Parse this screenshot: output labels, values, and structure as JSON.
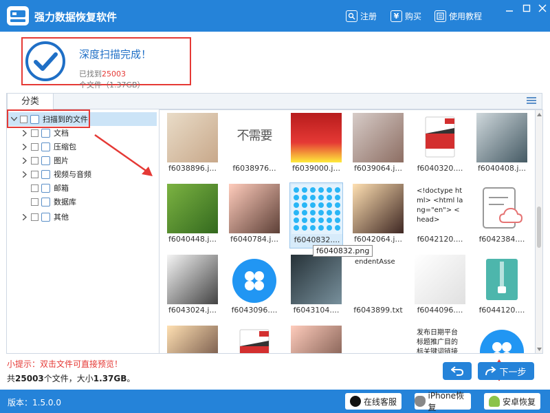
{
  "window": {
    "title": "强力数据恢复软件",
    "links": [
      {
        "label": "注册",
        "icon": "register-icon"
      },
      {
        "label": "购买",
        "icon": "yen-icon"
      },
      {
        "label": "使用教程",
        "icon": "tutorial-icon"
      }
    ]
  },
  "scan": {
    "title": "深度扫描完成！",
    "found_prefix": "已找到",
    "found_count": "25003",
    "found_suffix": "个文件（1.37GB）"
  },
  "category": {
    "tab_label": "分类"
  },
  "tree": [
    {
      "label": "扫描到的文件",
      "icon": "list-icon",
      "expanded": true,
      "selected": true
    },
    {
      "label": "文档",
      "icon": "document-icon"
    },
    {
      "label": "压缩包",
      "icon": "archive-icon"
    },
    {
      "label": "图片",
      "icon": "image-icon"
    },
    {
      "label": "视频与音频",
      "icon": "media-icon"
    },
    {
      "label": "邮箱",
      "icon": "mail-icon"
    },
    {
      "label": "数据库",
      "icon": "database-icon"
    },
    {
      "label": "其他",
      "icon": "more-icon"
    }
  ],
  "files": [
    {
      "name": "f6038896.j..."
    },
    {
      "name": "f6038976...",
      "text": "不需要"
    },
    {
      "name": "f6039000.j..."
    },
    {
      "name": "f6039064.j..."
    },
    {
      "name": "f6040320...."
    },
    {
      "name": "f6040408.j..."
    },
    {
      "name": "f6040448.j..."
    },
    {
      "name": "f6040784.j..."
    },
    {
      "name": "f6040832....",
      "selected": true
    },
    {
      "name": "f6042064.j..."
    },
    {
      "name": "f6042120....",
      "text": "<!doctype html> <html lang=\"en\"> <head>"
    },
    {
      "name": "f6042384...."
    },
    {
      "name": "f6043024.j..."
    },
    {
      "name": "f6043096...."
    },
    {
      "name": "f6043104...."
    },
    {
      "name": "f6043899.txt",
      "text": "endentAsse"
    },
    {
      "name": "f6044096...."
    },
    {
      "name": "f6044120...."
    },
    {
      "name": ""
    },
    {
      "name": ""
    },
    {
      "name": ""
    },
    {
      "name": ""
    },
    {
      "name": "",
      "text": "发布日期平台标题推广目的标关键词链接账号发布人报备人"
    },
    {
      "name": ""
    }
  ],
  "tooltip": "f6040832.png",
  "bottom": {
    "hint": "小提示：双击文件可直接预览！",
    "summary_prefix": "共",
    "summary_count": "25003",
    "summary_mid": "个文件，大小",
    "summary_size": "1.37GB",
    "summary_suffix": "。",
    "next_label": "下一步"
  },
  "footer": {
    "version": "版本：1.5.0.0",
    "buttons": [
      {
        "label": "在线客服",
        "icon": "qq-icon"
      },
      {
        "label": "iPhone恢复",
        "icon": "apple-icon"
      },
      {
        "label": "安卓恢复",
        "icon": "android-icon"
      }
    ]
  },
  "colors": {
    "primary": "#2583d9",
    "highlight": "#e53935"
  }
}
